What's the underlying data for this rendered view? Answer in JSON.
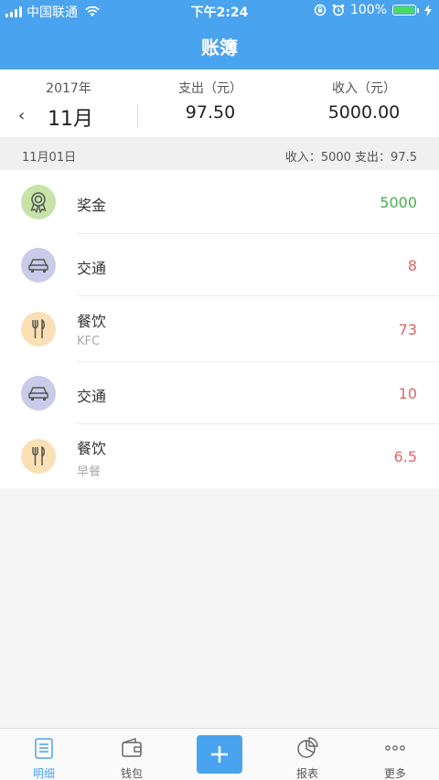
{
  "status_bar": {
    "carrier": "中国联通",
    "time": "下午2:24",
    "battery": "100%"
  },
  "nav": {
    "title": "账簿"
  },
  "summary": {
    "year": "2017年",
    "month": "11月",
    "expense_label": "支出（元）",
    "expense_value": "97.50",
    "income_label": "收入（元）",
    "income_value": "5000.00"
  },
  "day": {
    "date": "11月01日",
    "summary": "收入：5000 支出：97.5"
  },
  "records": [
    {
      "category": "奖金",
      "note": "",
      "amount": "5000",
      "type": "income",
      "icon": "award-icon"
    },
    {
      "category": "交通",
      "note": "",
      "amount": "8",
      "type": "expense",
      "icon": "car-icon"
    },
    {
      "category": "餐饮",
      "note": "KFC",
      "amount": "73",
      "type": "expense",
      "icon": "fork-knife-icon"
    },
    {
      "category": "交通",
      "note": "",
      "amount": "10",
      "type": "expense",
      "icon": "car-icon"
    },
    {
      "category": "餐饮",
      "note": "早餐",
      "amount": "6.5",
      "type": "expense",
      "icon": "fork-knife-icon"
    }
  ],
  "tabs": [
    {
      "label": "明细",
      "icon": "list-doc-icon",
      "active": true
    },
    {
      "label": "钱包",
      "icon": "wallet-icon",
      "active": false
    },
    {
      "label": "",
      "icon": "plus-icon",
      "active": false
    },
    {
      "label": "报表",
      "icon": "pie-chart-icon",
      "active": false
    },
    {
      "label": "更多",
      "icon": "more-dots-icon",
      "active": false
    }
  ],
  "colors": {
    "primary": "#4aa3ee",
    "income": "#4caf50",
    "expense": "#e06666"
  }
}
